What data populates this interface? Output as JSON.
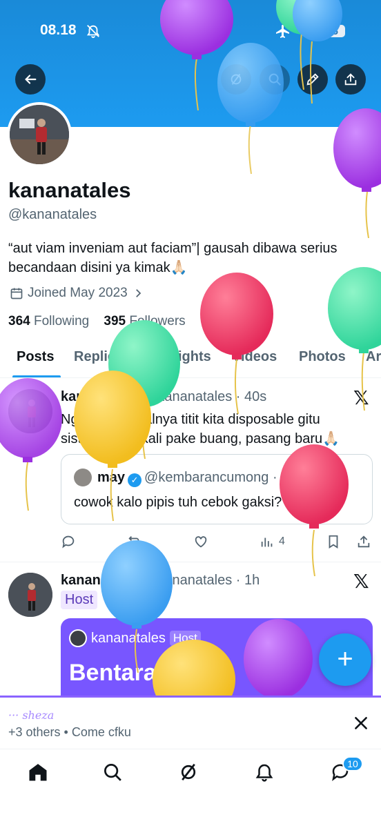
{
  "status_bar": {
    "time": "08.18",
    "battery": "45"
  },
  "header": {
    "back_icon": "arrow-left-icon",
    "grok_icon": "grok-icon",
    "search_icon": "search-icon",
    "edit_icon": "pencil-icon",
    "share_icon": "share-icon"
  },
  "profile": {
    "name": "kananatales",
    "handle": "@kananatales",
    "bio": "“aut viam inveniam aut faciam”| gausah dibawa serius becandaan disini ya kimak🙏🏻",
    "joined": "Joined May 2023",
    "following_count": "364",
    "following_label": "Following",
    "followers_count": "395",
    "followers_label": "Followers"
  },
  "tabs": [
    "Posts",
    "Replies",
    "Highlights",
    "Videos",
    "Photos",
    "Articles"
  ],
  "posts": [
    {
      "name": "kananatales",
      "meta": "@kananatales · 40s",
      "text": "Nggak kak soalnya titit kita disposable gitu sistemnya sekali pake buang, pasang baru🙏🏻",
      "quote": {
        "name": "may",
        "meta": "@kembarancumong · 54m",
        "text": "cowok kalo pipis tuh cebok gaksi?"
      },
      "views": "4"
    },
    {
      "name": "kananatales",
      "meta": "@kananatales · 1h",
      "host_label": "Host",
      "space": {
        "host_name": "kananatales",
        "host_tag": "Host",
        "title": "Bentaran aja"
      }
    }
  ],
  "fab": {
    "icon": "plus"
  },
  "spaces_bar": {
    "listeners": "··· sheza",
    "subtitle": "+3 others • Come cfku"
  },
  "bottom_nav": {
    "items": [
      "home-icon",
      "search-icon",
      "grok-icon",
      "notifications-icon",
      "messages-icon"
    ],
    "messages_badge": "10"
  },
  "colors": {
    "accent": "#1d9bf0",
    "space": "#7856ff"
  }
}
